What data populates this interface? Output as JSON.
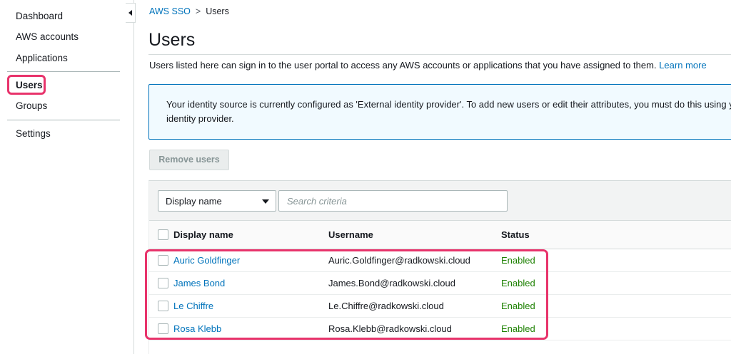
{
  "sidebar": {
    "items": [
      {
        "label": "Dashboard"
      },
      {
        "label": "AWS accounts"
      },
      {
        "label": "Applications"
      },
      {
        "label": "Users"
      },
      {
        "label": "Groups"
      },
      {
        "label": "Settings"
      }
    ],
    "active": "Users"
  },
  "breadcrumb": {
    "root": "AWS SSO",
    "separator": ">",
    "current": "Users"
  },
  "page": {
    "title": "Users",
    "description": "Users listed here can sign in to the user portal to access any AWS accounts or applications that you have assigned to them.",
    "learn_more": "Learn more"
  },
  "info": {
    "text": "Your identity source is currently configured as 'External identity provider'. To add new users or edit their attributes, you must do this using your identity provider."
  },
  "toolbar": {
    "remove_label": "Remove users"
  },
  "filter": {
    "selected": "Display name",
    "placeholder": "Search criteria"
  },
  "table": {
    "columns": [
      "Display name",
      "Username",
      "Status"
    ],
    "rows": [
      {
        "display_name": "Auric Goldfinger",
        "username": "Auric.Goldfinger@radkowski.cloud",
        "status": "Enabled"
      },
      {
        "display_name": "James Bond",
        "username": "James.Bond@radkowski.cloud",
        "status": "Enabled"
      },
      {
        "display_name": "Le Chiffre",
        "username": "Le.Chiffre@radkowski.cloud",
        "status": "Enabled"
      },
      {
        "display_name": "Rosa Klebb",
        "username": "Rosa.Klebb@radkowski.cloud",
        "status": "Enabled"
      }
    ]
  },
  "colors": {
    "link": "#0073bb",
    "status_enabled": "#1d8102",
    "annotation": "#e8336b",
    "info_bg": "#f1faff"
  }
}
